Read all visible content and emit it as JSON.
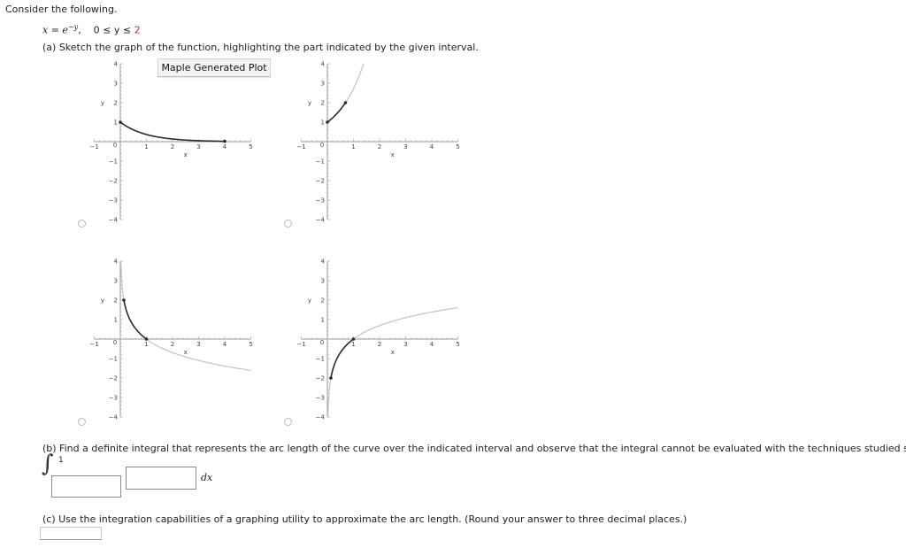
{
  "intro": "Consider the following.",
  "formula": {
    "lhs": "x = e",
    "exponent": "−y",
    "sep": ",",
    "interval_left": "0 ≤ y ≤ ",
    "interval_upper": "2",
    "upper_color": "#e0261b"
  },
  "part_a": {
    "prompt": "(a) Sketch the graph of the function, highlighting the part indicated by the given interval.",
    "maple_button": "Maple Generated Plot",
    "axis": {
      "xlabel": "x",
      "ylabel": "y",
      "xrange": [
        -1,
        5
      ],
      "yrange": [
        -4,
        4
      ],
      "xticks": [
        "−1",
        "1",
        "2",
        "3",
        "4",
        "5"
      ],
      "xtick_values": [
        -1,
        1,
        2,
        3,
        4,
        5
      ],
      "yticks": [
        "4",
        "3",
        "2",
        "1",
        "0",
        "−1",
        "−2",
        "−3",
        "−4"
      ],
      "ytick_values": [
        4,
        3,
        2,
        1,
        0,
        -1,
        -2,
        -3,
        -4
      ]
    },
    "options": [
      {
        "id": "option-1",
        "selected": false,
        "curve": "y = e^(-x)",
        "highlight_x": [
          0,
          4
        ],
        "gray_x": null,
        "endpoints": [
          [
            0,
            1
          ],
          [
            4,
            0.018
          ]
        ]
      },
      {
        "id": "option-2",
        "selected": false,
        "curve": "y = e^(x)",
        "highlight_x": [
          0,
          0.693
        ],
        "gray_x": [
          0,
          1.386
        ],
        "endpoints": [
          [
            0,
            1
          ],
          [
            0.693,
            2
          ]
        ]
      },
      {
        "id": "option-3",
        "selected": false,
        "curve": "y = -ln(x)",
        "highlight_x": [
          0.135,
          1
        ],
        "gray_x": [
          0.018,
          5
        ],
        "endpoints": [
          [
            0.135,
            2
          ],
          [
            1,
            0
          ]
        ]
      },
      {
        "id": "option-4",
        "selected": false,
        "curve": "y = ln(x)",
        "highlight_x": [
          0.135,
          1
        ],
        "gray_x": [
          0.018,
          5
        ],
        "endpoints": [
          [
            0.135,
            -2
          ],
          [
            1,
            0
          ]
        ]
      }
    ],
    "colors": {
      "highlight": "#2b2b2b",
      "gray": "#c4c4c4",
      "axis": "#9a9a9a"
    }
  },
  "part_b": {
    "prompt": "(b) Find a definite integral that represents the arc length of the curve over the indicated interval and observe that the integral cannot be evaluated with the techniques studied so far.",
    "upper_limit": "1",
    "lower_limit_value": "",
    "integrand_value": "",
    "differential": "dx"
  },
  "part_c": {
    "prompt": "(c) Use the integration capabilities of a graphing utility to approximate the arc length. (Round your answer to three decimal places.)",
    "answer_value": ""
  }
}
